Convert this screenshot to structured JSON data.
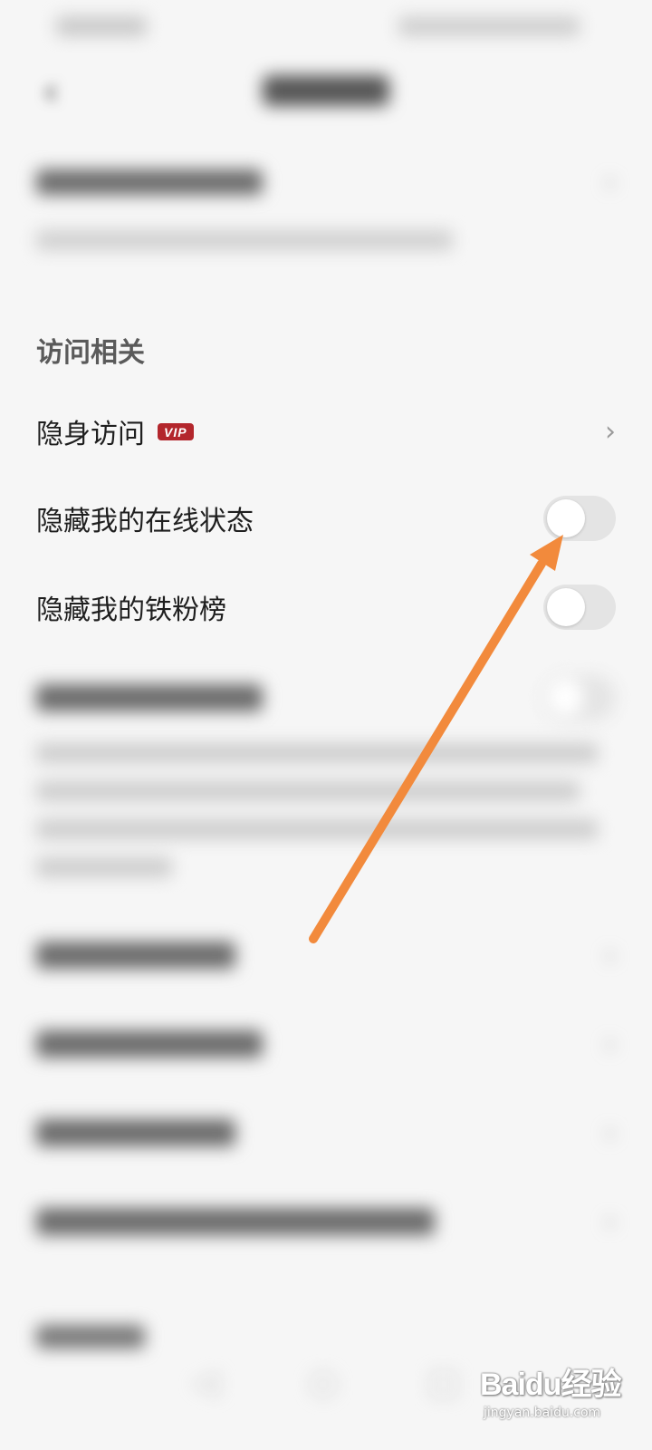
{
  "status_bar": {
    "left": "",
    "right": ""
  },
  "nav": {
    "title": "",
    "back_icon": "chevron-left-icon"
  },
  "hide_account": {
    "label": "",
    "description": ""
  },
  "section_visit": {
    "header": "访问相关"
  },
  "items": {
    "invisible_visit": {
      "label": "隐身访问",
      "badge": "VIP",
      "badge_color": "#b3262c"
    },
    "hide_online_status": {
      "label": "隐藏我的在线状态",
      "toggle_on": false
    },
    "hide_fans_list": {
      "label": "隐藏我的铁粉榜",
      "toggle_on": false
    },
    "blurred_toggle_item": {
      "label": "",
      "toggle_on": false,
      "description": ""
    },
    "blurred_item_1": {
      "label": ""
    },
    "blurred_item_2": {
      "label": ""
    },
    "blurred_item_3": {
      "label": ""
    },
    "blurred_item_4": {
      "label": ""
    }
  },
  "footer_section": {
    "header": ""
  },
  "annotation": {
    "arrow_color": "#f28a3c",
    "type": "arrow"
  },
  "watermark": {
    "logo": "Baidu经验",
    "url": "jingyan.baidu.com"
  }
}
